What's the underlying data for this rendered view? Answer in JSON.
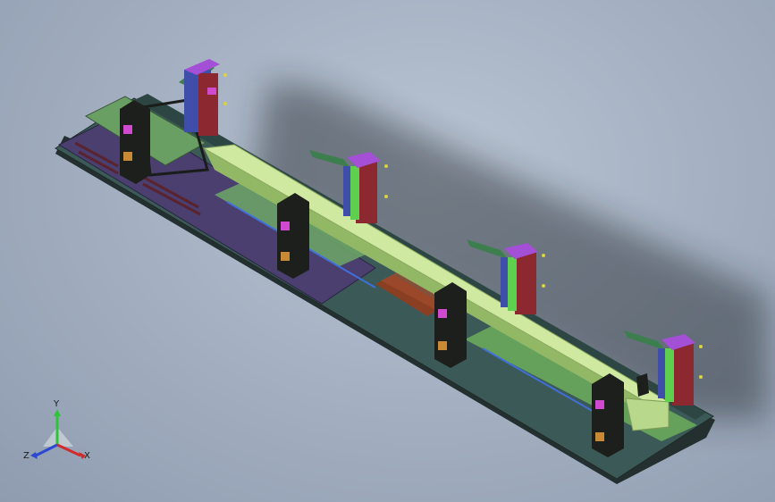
{
  "viewport": {
    "colors": {
      "background": "#a9b4c4",
      "base_plate": "#3b5a57",
      "base_edge": "#23302f",
      "purple_plate": "#4a3f6e",
      "green_plate": "#6a9f63",
      "beam": "#cfe9a0",
      "beam_dark": "#93b865",
      "post": "#1c1f1c",
      "clamp_body": "#8c2830",
      "clamp_face": "#5fcf4f",
      "clamp_cap": "#a34fd6",
      "clamp_arm": "#3d7e4e",
      "cylinder": "#3f4ea8",
      "brown_block": "#8a3f23",
      "pink": "#d04ad0",
      "pin": "#d9d33f"
    }
  },
  "triad": {
    "x_label": "X",
    "y_label": "Y",
    "z_label": "Z",
    "x_color": "#d22b2b",
    "y_color": "#2ec43a",
    "z_color": "#2b48d2"
  }
}
